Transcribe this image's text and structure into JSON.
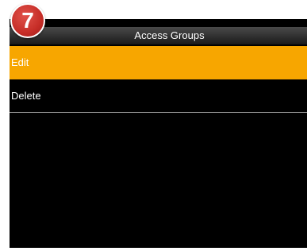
{
  "badge": {
    "number": "7",
    "color": "#c62d27"
  },
  "header": {
    "title": "Access Groups"
  },
  "menu": {
    "items": [
      {
        "label": "Edit",
        "selected": true
      },
      {
        "label": "Delete",
        "selected": false
      }
    ]
  },
  "colors": {
    "highlight": "#f7a600",
    "background": "#000000",
    "text": "#ffffff"
  }
}
